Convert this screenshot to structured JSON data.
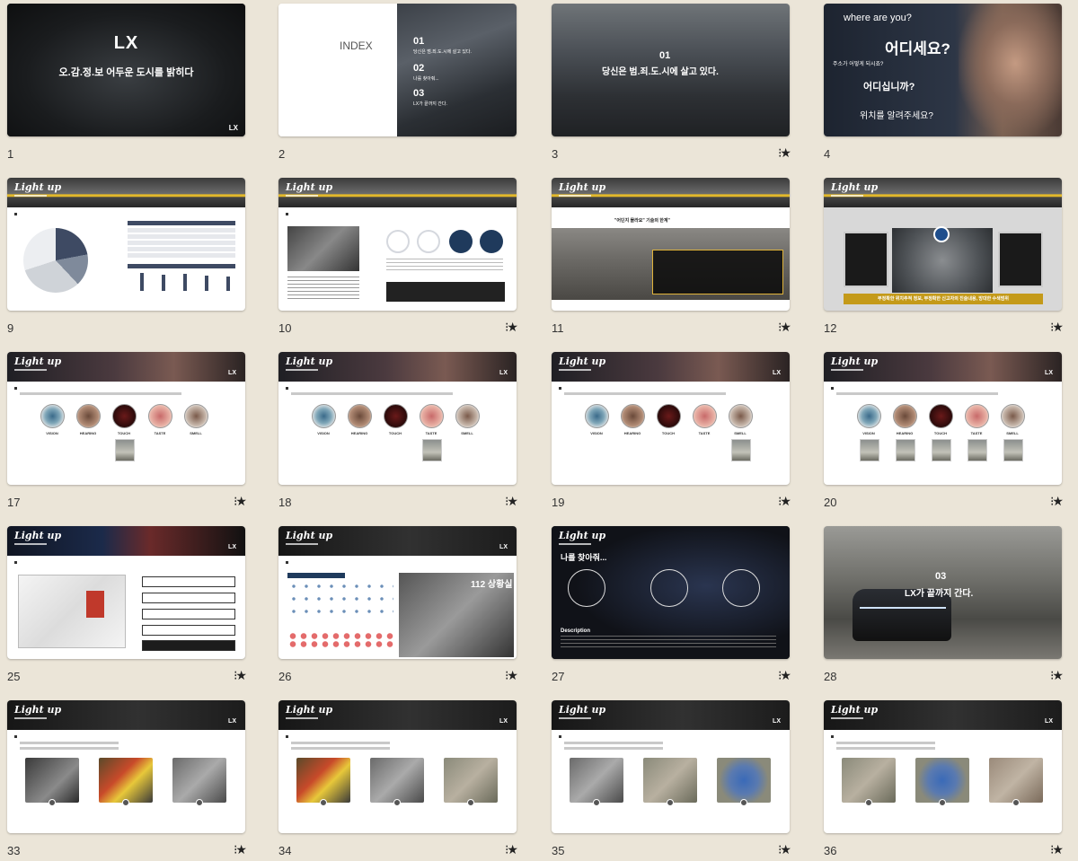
{
  "slides": [
    {
      "number": "1",
      "starred": false,
      "lines": [
        "LX",
        "오.감.정.보 어두운 도시를 밝히다",
        "LX"
      ]
    },
    {
      "number": "2",
      "starred": false,
      "lines": [
        "INDEX",
        "01",
        "당신은 범.죄.도.시에 살고 있다.",
        "02",
        "나를 찾아줘...",
        "03",
        "LX가 끝까지 간다."
      ]
    },
    {
      "number": "3",
      "starred": true,
      "lines": [
        "01",
        "당신은 범.죄.도.시에 살고 있다."
      ]
    },
    {
      "number": "4",
      "starred": false,
      "lines": [
        "where are you?",
        "어디세요?",
        "주소가 어떻게 되시죠?",
        "어디십니까?",
        "위치를 알려주세요?"
      ]
    },
    {
      "number": "9",
      "starred": false,
      "lines": [
        "Light up"
      ]
    },
    {
      "number": "10",
      "starred": true,
      "lines": [
        "Light up"
      ]
    },
    {
      "number": "11",
      "starred": true,
      "lines": [
        "Light up",
        "\"어딘지 몰라요\" 기술의 한계\""
      ]
    },
    {
      "number": "12",
      "starred": true,
      "lines": [
        "Light up",
        "부정확한 위치추적 정보, 부정확한 신고자의 진술내용, 방대한 수색범위"
      ]
    },
    {
      "number": "17",
      "starred": true,
      "lines": [
        "Light up",
        "VISION",
        "HEARING",
        "TOUCH",
        "TASTE",
        "SMELL"
      ]
    },
    {
      "number": "18",
      "starred": true,
      "lines": [
        "Light up",
        "VISION",
        "HEARING",
        "TOUCH",
        "TASTE",
        "SMELL"
      ]
    },
    {
      "number": "19",
      "starred": true,
      "lines": [
        "Light up",
        "VISION",
        "HEARING",
        "TOUCH",
        "TASTE",
        "SMELL"
      ]
    },
    {
      "number": "20",
      "starred": true,
      "lines": [
        "Light up",
        "VISION",
        "HEARING",
        "TOUCH",
        "TASTE",
        "SMELL"
      ]
    },
    {
      "number": "25",
      "starred": true,
      "lines": [
        "Light up"
      ]
    },
    {
      "number": "26",
      "starred": true,
      "lines": [
        "Light up",
        "112 상황실"
      ]
    },
    {
      "number": "27",
      "starred": true,
      "lines": [
        "Light up",
        "나를 찾아줘...",
        "Description"
      ]
    },
    {
      "number": "28",
      "starred": true,
      "lines": [
        "03",
        "LX가 끝까지 간다."
      ]
    },
    {
      "number": "33",
      "starred": true,
      "lines": [
        "Light up"
      ]
    },
    {
      "number": "34",
      "starred": true,
      "lines": [
        "Light up"
      ]
    },
    {
      "number": "35",
      "starred": true,
      "lines": [
        "Light up"
      ]
    },
    {
      "number": "36",
      "starred": true,
      "lines": [
        "Light up"
      ]
    }
  ],
  "star_glyph": "⁝★"
}
